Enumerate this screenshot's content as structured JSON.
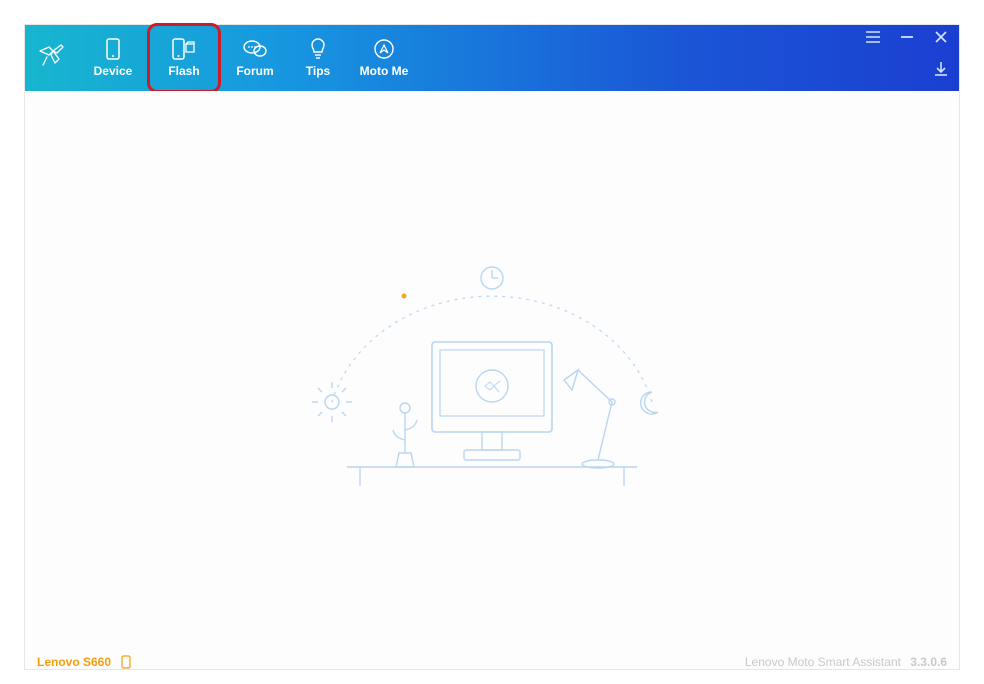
{
  "nav": {
    "device": "Device",
    "flash": "Flash",
    "forum": "Forum",
    "tips": "Tips",
    "motome": "Moto Me"
  },
  "footer": {
    "device_model": "Lenovo S660",
    "app_name": "Lenovo Moto Smart Assistant",
    "version": "3.3.0.6"
  },
  "icons": {
    "logo": "hummingbird-icon",
    "menu": "menu-icon",
    "minimize": "minimize-icon",
    "close": "close-icon",
    "download": "download-icon"
  }
}
